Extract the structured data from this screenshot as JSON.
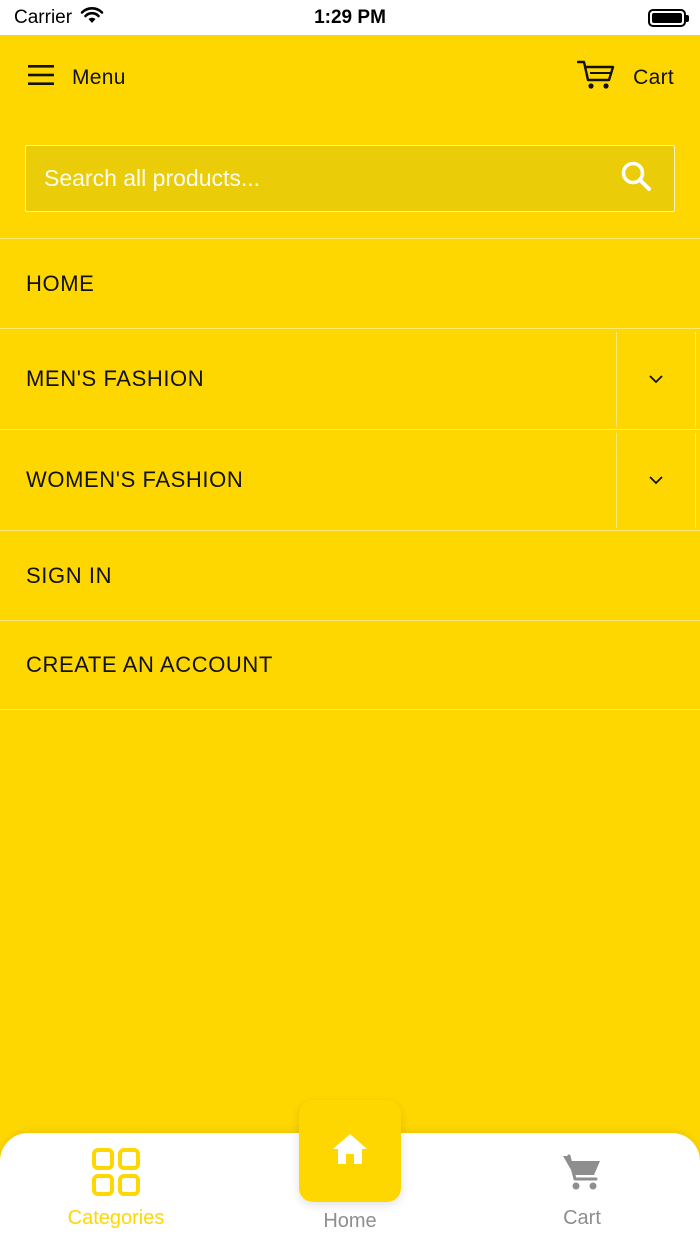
{
  "status_bar": {
    "carrier": "Carrier",
    "time": "1:29 PM"
  },
  "header": {
    "menu_label": "Menu",
    "cart_label": "Cart"
  },
  "search": {
    "placeholder": "Search all products..."
  },
  "nav": {
    "items": [
      {
        "label": "HOME",
        "expandable": false
      },
      {
        "label": "MEN'S FASHION",
        "expandable": true
      },
      {
        "label": "WOMEN'S FASHION",
        "expandable": true
      },
      {
        "label": "SIGN IN",
        "expandable": false
      },
      {
        "label": "CREATE AN ACCOUNT",
        "expandable": false
      }
    ]
  },
  "tab_bar": {
    "categories_label": "Categories",
    "home_label": "Home",
    "cart_label": "Cart",
    "active_tab": "Categories"
  },
  "colors": {
    "background": "#FFD700",
    "search_background": "#EACC08",
    "active_tab": "#FFD700",
    "inactive_tab": "#8e8e8e"
  },
  "icons": {
    "menu": "hamburger-icon",
    "cart": "cart-icon",
    "search": "search-icon",
    "chevron": "chevron-down-icon",
    "categories": "grid-icon",
    "home": "home-icon",
    "tab_cart": "shopping-cart-icon",
    "wifi": "wifi-icon",
    "battery": "battery-icon"
  }
}
